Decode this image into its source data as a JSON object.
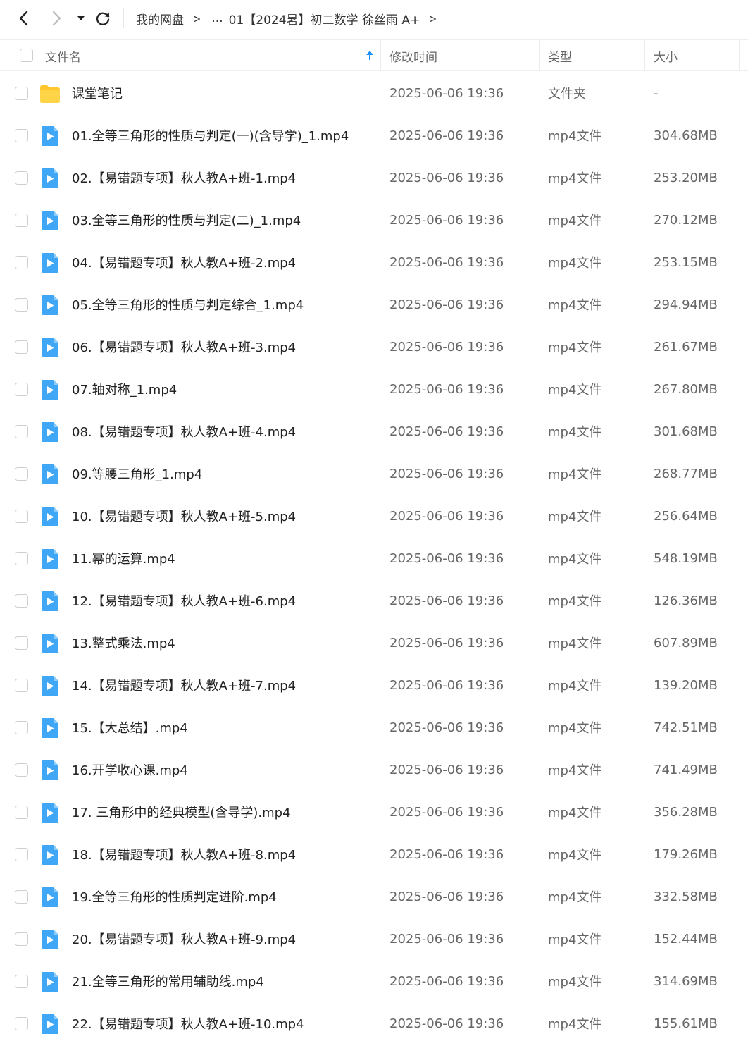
{
  "nav": {
    "breadcrumb_root": "我的网盘",
    "breadcrumb_ellipsis": "...",
    "breadcrumb_current": "01【2024暑】初二数学 徐丝雨 A+",
    "chevron": ">"
  },
  "columns": {
    "name": "文件名",
    "mtime": "修改时间",
    "type": "类型",
    "size": "大小"
  },
  "colors": {
    "folder": "#FFC62E",
    "video_icon": "#3FA7F5",
    "sort_arrow": "#1E90FF"
  },
  "files": [
    {
      "icon": "folder-icon",
      "name": "课堂笔记",
      "mtime": "2025-06-06 19:36",
      "type": "文件夹",
      "size": "-"
    },
    {
      "icon": "video-file-icon",
      "name": "01.全等三角形的性质与判定(一)(含导学)_1.mp4",
      "mtime": "2025-06-06 19:36",
      "type": "mp4文件",
      "size": "304.68MB"
    },
    {
      "icon": "video-file-icon",
      "name": "02.【易错题专项】秋人教A+班-1.mp4",
      "mtime": "2025-06-06 19:36",
      "type": "mp4文件",
      "size": "253.20MB"
    },
    {
      "icon": "video-file-icon",
      "name": "03.全等三角形的性质与判定(二)_1.mp4",
      "mtime": "2025-06-06 19:36",
      "type": "mp4文件",
      "size": "270.12MB"
    },
    {
      "icon": "video-file-icon",
      "name": "04.【易错题专项】秋人教A+班-2.mp4",
      "mtime": "2025-06-06 19:36",
      "type": "mp4文件",
      "size": "253.15MB"
    },
    {
      "icon": "video-file-icon",
      "name": "05.全等三角形的性质与判定综合_1.mp4",
      "mtime": "2025-06-06 19:36",
      "type": "mp4文件",
      "size": "294.94MB"
    },
    {
      "icon": "video-file-icon",
      "name": "06.【易错题专项】秋人教A+班-3.mp4",
      "mtime": "2025-06-06 19:36",
      "type": "mp4文件",
      "size": "261.67MB"
    },
    {
      "icon": "video-file-icon",
      "name": "07.轴对称_1.mp4",
      "mtime": "2025-06-06 19:36",
      "type": "mp4文件",
      "size": "267.80MB"
    },
    {
      "icon": "video-file-icon",
      "name": "08.【易错题专项】秋人教A+班-4.mp4",
      "mtime": "2025-06-06 19:36",
      "type": "mp4文件",
      "size": "301.68MB"
    },
    {
      "icon": "video-file-icon",
      "name": "09.等腰三角形_1.mp4",
      "mtime": "2025-06-06 19:36",
      "type": "mp4文件",
      "size": "268.77MB"
    },
    {
      "icon": "video-file-icon",
      "name": "10.【易错题专项】秋人教A+班-5.mp4",
      "mtime": "2025-06-06 19:36",
      "type": "mp4文件",
      "size": "256.64MB"
    },
    {
      "icon": "video-file-icon",
      "name": "11.幂的运算.mp4",
      "mtime": "2025-06-06 19:36",
      "type": "mp4文件",
      "size": "548.19MB"
    },
    {
      "icon": "video-file-icon",
      "name": "12.【易错题专项】秋人教A+班-6.mp4",
      "mtime": "2025-06-06 19:36",
      "type": "mp4文件",
      "size": "126.36MB"
    },
    {
      "icon": "video-file-icon",
      "name": "13.整式乘法.mp4",
      "mtime": "2025-06-06 19:36",
      "type": "mp4文件",
      "size": "607.89MB"
    },
    {
      "icon": "video-file-icon",
      "name": "14.【易错题专项】秋人教A+班-7.mp4",
      "mtime": "2025-06-06 19:36",
      "type": "mp4文件",
      "size": "139.20MB"
    },
    {
      "icon": "video-file-icon",
      "name": "15.【大总结】.mp4",
      "mtime": "2025-06-06 19:36",
      "type": "mp4文件",
      "size": "742.51MB"
    },
    {
      "icon": "video-file-icon",
      "name": "16.开学收心课.mp4",
      "mtime": "2025-06-06 19:36",
      "type": "mp4文件",
      "size": "741.49MB"
    },
    {
      "icon": "video-file-icon",
      "name": "17. 三角形中的经典模型(含导学).mp4",
      "mtime": "2025-06-06 19:36",
      "type": "mp4文件",
      "size": "356.28MB"
    },
    {
      "icon": "video-file-icon",
      "name": "18.【易错题专项】秋人教A+班-8.mp4",
      "mtime": "2025-06-06 19:36",
      "type": "mp4文件",
      "size": "179.26MB"
    },
    {
      "icon": "video-file-icon",
      "name": "19.全等三角形的性质判定进阶.mp4",
      "mtime": "2025-06-06 19:36",
      "type": "mp4文件",
      "size": "332.58MB"
    },
    {
      "icon": "video-file-icon",
      "name": "20.【易错题专项】秋人教A+班-9.mp4",
      "mtime": "2025-06-06 19:36",
      "type": "mp4文件",
      "size": "152.44MB"
    },
    {
      "icon": "video-file-icon",
      "name": "21.全等三角形的常用辅助线.mp4",
      "mtime": "2025-06-06 19:36",
      "type": "mp4文件",
      "size": "314.69MB"
    },
    {
      "icon": "video-file-icon",
      "name": "22.【易错题专项】秋人教A+班-10.mp4",
      "mtime": "2025-06-06 19:36",
      "type": "mp4文件",
      "size": "155.61MB"
    }
  ]
}
